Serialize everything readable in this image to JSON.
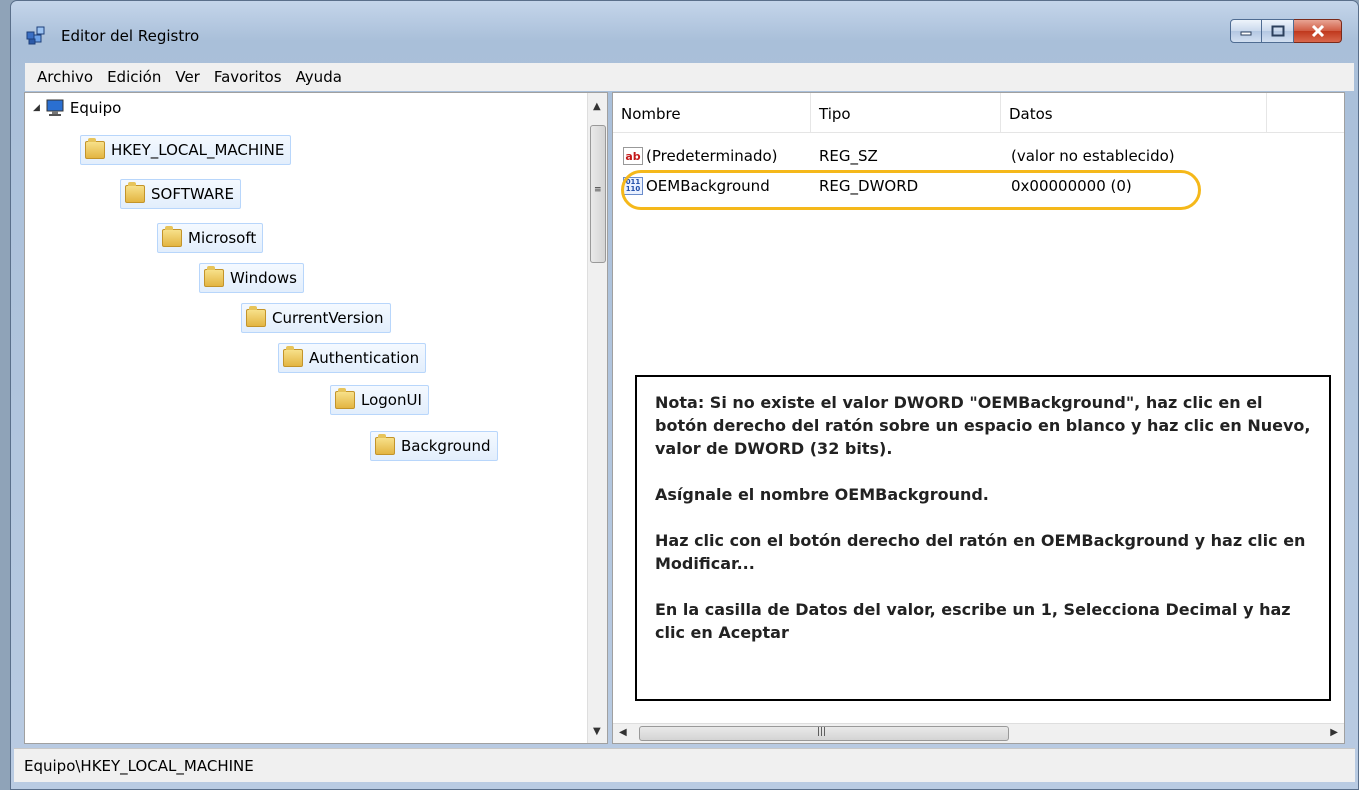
{
  "window": {
    "title": "Editor del Registro"
  },
  "menu": {
    "items": [
      "Archivo",
      "Edición",
      "Ver",
      "Favoritos",
      "Ayuda"
    ]
  },
  "tree": {
    "root": "Equipo",
    "nodes": [
      "HKEY_LOCAL_MACHINE",
      "SOFTWARE",
      "Microsoft",
      "Windows",
      "CurrentVersion",
      "Authentication",
      "LogonUI",
      "Background"
    ]
  },
  "list": {
    "headers": [
      "Nombre",
      "Tipo",
      "Datos"
    ],
    "rows": [
      {
        "icon": "string-value-icon",
        "name": "(Predeterminado)",
        "type": "REG_SZ",
        "data": "(valor no establecido)"
      },
      {
        "icon": "binary-value-icon",
        "name": "OEMBackground",
        "type": "REG_DWORD",
        "data": "0x00000000 (0)"
      }
    ],
    "icon_labels": {
      "string": "ab",
      "binary": "011 110"
    }
  },
  "note": {
    "p1": "Nota: Si no existe el valor DWORD \"OEMBackground\", haz clic en el botón derecho del ratón sobre un espacio en blanco y haz clic en Nuevo, valor de DWORD (32 bits).",
    "p2": "Asígnale el nombre OEMBackground.",
    "p3": "Haz clic con el botón derecho del ratón en OEMBackground y haz clic en Modificar...",
    "p4": "En la casilla de Datos del valor, escribe un 1, Selecciona Decimal y haz clic en Aceptar"
  },
  "status": {
    "path": "Equipo\\HKEY_LOCAL_MACHINE"
  },
  "colors": {
    "highlight": "#f5b81a",
    "selection": "#e2eefc"
  }
}
